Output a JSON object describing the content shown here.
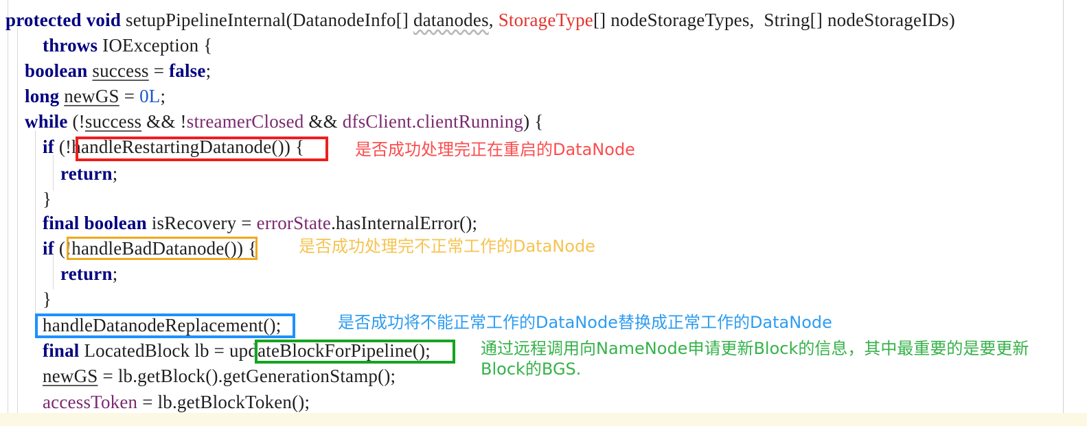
{
  "editor": {
    "language": "java",
    "background": "#ffffff",
    "current_line_highlight": "#fdf8e3",
    "code_lines": [
      {
        "indent": 0,
        "text": "protected void setupPipelineInternal(DatanodeInfo[] datanodes, StorageType[] nodeStorageTypes, String[] nodeStorageIDs)"
      },
      {
        "indent": 4,
        "text": "throws IOException {"
      },
      {
        "indent": 2,
        "text": "boolean success = false;"
      },
      {
        "indent": 2,
        "text": "long newGS = 0L;"
      },
      {
        "indent": 2,
        "text": "while (!success && !streamerClosed && dfsClient.clientRunning) {"
      },
      {
        "indent": 4,
        "text": "if (!handleRestartingDatanode()) {"
      },
      {
        "indent": 6,
        "text": "return;"
      },
      {
        "indent": 4,
        "text": "}"
      },
      {
        "indent": 4,
        "text": "final boolean isRecovery = errorState.hasInternalError();"
      },
      {
        "indent": 4,
        "text": "if (!handleBadDatanode()) {"
      },
      {
        "indent": 6,
        "text": "return;"
      },
      {
        "indent": 4,
        "text": "}"
      },
      {
        "indent": 4,
        "text": "handleDatanodeReplacement();"
      },
      {
        "indent": 4,
        "text": "final LocatedBlock lb = updateBlockForPipeline();"
      },
      {
        "indent": 4,
        "text": "newGS = lb.getBlock().getGenerationStamp();"
      },
      {
        "indent": 4,
        "text": "accessToken = lb.getBlockToken();"
      }
    ],
    "tokens": {
      "line1": {
        "kw_protected": "protected",
        "kw_void": "void",
        "method_name": "setupPipelineInternal",
        "paren_open": "(",
        "type_datanodeinfo": "DatanodeInfo[] ",
        "param_datanodes": "datanodes",
        "comma1": ", ",
        "type_storagetype": "StorageType",
        "brackets1": "[] nodeStorageTypes,  ",
        "type_string": "String",
        "brackets2": "[] nodeStorageIDs)"
      },
      "line2": {
        "kw_throws": "throws",
        "type_ioexception": " IOException {"
      },
      "line3": {
        "kw_boolean": "boolean",
        "var_success": "success",
        "eq": " = ",
        "kw_false": "false",
        "semi": ";"
      },
      "line4": {
        "kw_long": "long",
        "var_newgs": "newGS",
        "eq": " = ",
        "lit_0l": "0L",
        "semi": ";"
      },
      "line5": {
        "kw_while": "while",
        "open": " (!",
        "var_success": "success",
        "and1": " && !",
        "field_streamerclosed": "streamerClosed",
        "and2": " && ",
        "field_dfsclient": "dfsClient.clientRunning",
        "close": ") {"
      },
      "line6": {
        "kw_if": "if",
        "expr": " (!handleRestartingDatanode()",
        "tail": ") {"
      },
      "line7": {
        "kw_return": "return",
        "semi": ";"
      },
      "line8": {
        "brace": "}"
      },
      "line9": {
        "kw_final": "final",
        "kw_boolean": " boolean",
        "var_isrecovery": " isRecovery = ",
        "field_errorstate": "errorState",
        "call": ".hasInternalError();"
      },
      "line10": {
        "kw_if": "if",
        "expr": " (!handleBadDatanode()",
        "tail": ") {"
      },
      "line11": {
        "kw_return": "return",
        "semi": ";"
      },
      "line12": {
        "brace": "}"
      },
      "line13": {
        "call": "handleDatanodeReplacement();"
      },
      "line14": {
        "kw_final": "final",
        "type_lb": " LocatedBlock lb = ",
        "call": "updateBlockForPipeline",
        "tail": "();"
      },
      "line15": {
        "var_newgs": "newGS",
        "call": " = lb.getBlock().getGenerationStamp();"
      },
      "line16": {
        "field_accesstoken": "accessToken",
        "call": " = lb.getBlockToken();"
      }
    }
  },
  "annotations": [
    {
      "id": "annotation-restarting-datanode",
      "color": "#fb4d4d",
      "color_name": "red",
      "text": "是否成功处理完正在重启的DataNode",
      "target": "!handleRestartingDatanode()"
    },
    {
      "id": "annotation-bad-datanode",
      "color": "#f6c350",
      "color_name": "orange",
      "text": "是否成功处理完不正常工作的DataNode",
      "target": "!handleBadDatanode()"
    },
    {
      "id": "annotation-datanode-replacement",
      "color": "#2e9cf0",
      "color_name": "blue",
      "text": "是否成功将不能正常工作的DataNode替换成正常工作的DataNode",
      "target": "handleDatanodeReplacement();"
    },
    {
      "id": "annotation-update-block",
      "color": "#36b24a",
      "color_name": "green",
      "text_line1": "通过远程调用向NameNode申请更新Block的信息，其中最重要的是要更新",
      "text_line2": "Block的BGS.",
      "target": "updateBlockForPipeline"
    }
  ],
  "highlight_boxes": [
    {
      "id": "box-red",
      "color": "#ef1d1d",
      "encloses": "(!handleRestartingDatanode()"
    },
    {
      "id": "box-orange",
      "color": "#f0a81e",
      "encloses": "(!handleBadDatanode()"
    },
    {
      "id": "box-blue",
      "color": "#1e90ff",
      "encloses": "handleDatanodeReplacement();"
    },
    {
      "id": "box-green",
      "color": "#16a320",
      "encloses": "updateBlockForPipeline"
    }
  ]
}
